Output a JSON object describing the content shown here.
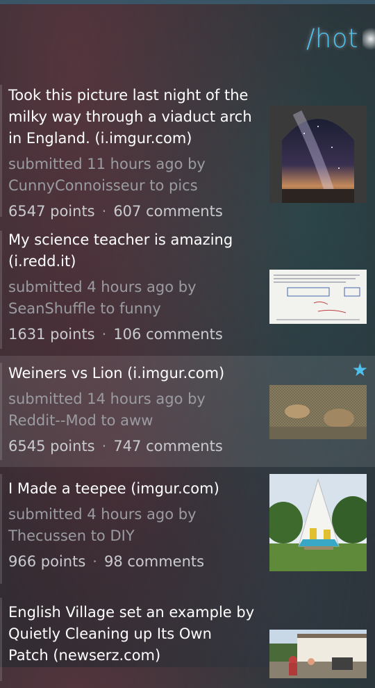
{
  "header": {
    "title": "/hot"
  },
  "posts": [
    {
      "title": "Took this picture last night of the milky way through a viaduct arch in England. (i.imgur.com)",
      "meta": "submitted 11 hours ago by CunnyConnoisseur to pics",
      "points": "6547 points",
      "comments": "607 comments",
      "starred": false
    },
    {
      "title": "My science teacher is amazing (i.redd.it)",
      "meta": "submitted 4 hours ago by SeanShuffle to funny",
      "points": "1631 points",
      "comments": "106 comments",
      "starred": false
    },
    {
      "title": "Weiners vs Lion (i.imgur.com)",
      "meta": "submitted 14 hours ago by Reddit--Mod to aww",
      "points": "6545 points",
      "comments": "747 comments",
      "starred": true
    },
    {
      "title": "I Made a teepee (imgur.com)",
      "meta": "submitted 4 hours ago by Thecussen to DIY",
      "points": "966 points",
      "comments": "98 comments",
      "starred": false
    },
    {
      "title": "English Village set an example by Quietly Cleaning up Its Own Patch (newserz.com)",
      "meta": "",
      "points": "",
      "comments": "",
      "starred": false
    }
  ],
  "separator": "·",
  "colors": {
    "accent": "#4fc0ec",
    "title": "#ffffff",
    "meta": "#9a9ca1"
  },
  "icons": {
    "star": "star-icon"
  }
}
